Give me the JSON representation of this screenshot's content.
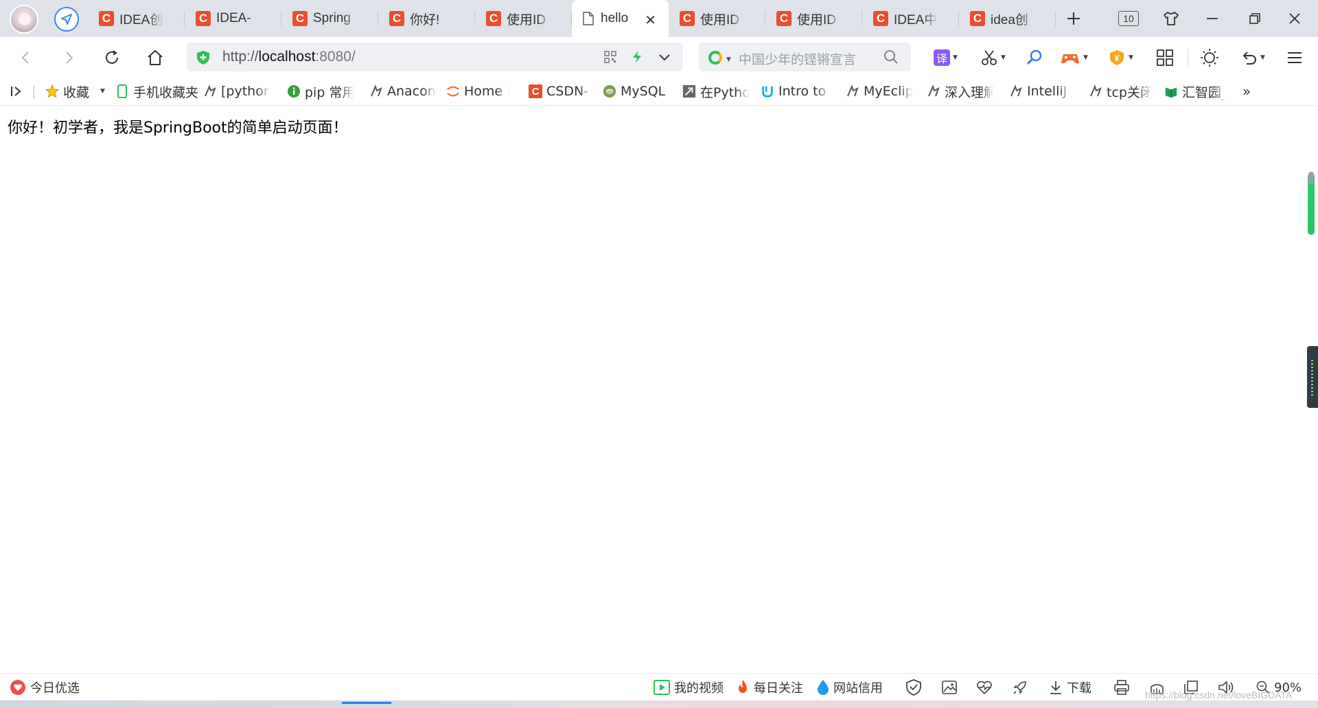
{
  "browser": {
    "tabs": [
      {
        "label": "IDEA创",
        "icon": "csdn-icon"
      },
      {
        "label": "IDEA-",
        "icon": "csdn-icon"
      },
      {
        "label": "Spring",
        "icon": "csdn-icon"
      },
      {
        "label": "你好!",
        "icon": "csdn-icon"
      },
      {
        "label": "使用ID",
        "icon": "csdn-icon"
      },
      {
        "label": "hello",
        "icon": "document-icon",
        "active": true
      },
      {
        "label": "使用ID",
        "icon": "csdn-icon"
      },
      {
        "label": "使用ID",
        "icon": "csdn-icon"
      },
      {
        "label": "IDEA中",
        "icon": "csdn-icon"
      },
      {
        "label": "idea创",
        "icon": "csdn-icon"
      }
    ],
    "tab_count": "10",
    "address": {
      "scheme": "http://",
      "host": "localhost",
      "port_path": ":8080/"
    },
    "search_placeholder": "中国少年的铿锵宣言"
  },
  "bookmarks": [
    {
      "label": "收藏",
      "icon": "star-icon"
    },
    {
      "label": "手机收藏夹",
      "icon": "phone-icon"
    },
    {
      "label": "[python]",
      "icon": "bookmark-logo-icon"
    },
    {
      "label": "pip 常用",
      "icon": "info-icon"
    },
    {
      "label": "Anacon",
      "icon": "bookmark-logo-icon"
    },
    {
      "label": "Home P",
      "icon": "jupyter-icon"
    },
    {
      "label": "CSDN-",
      "icon": "csdn-icon"
    },
    {
      "label": "MySQL",
      "icon": "mysql-icon"
    },
    {
      "label": "在Pytho",
      "icon": "arrow-icon"
    },
    {
      "label": "Intro to",
      "icon": "udacity-icon"
    },
    {
      "label": "MyEclip",
      "icon": "bookmark-logo-icon"
    },
    {
      "label": "深入理解",
      "icon": "bookmark-logo-icon"
    },
    {
      "label": "IntelliJ I",
      "icon": "bookmark-logo-icon"
    },
    {
      "label": "tcp关闭",
      "icon": "bookmark-logo-icon"
    },
    {
      "label": "汇智园_",
      "icon": "book-icon"
    }
  ],
  "bookmarks_more": "»",
  "page": {
    "text": "你好！初学者，我是SpringBoot的简单启动页面！"
  },
  "statusbar": {
    "left": "今日优选",
    "video": "我的视频",
    "daily": "每日关注",
    "credit": "网站信用",
    "download": "下载",
    "zoom": "90%"
  },
  "watermark": "https://blog.csdn.net/loveBIGDATA",
  "colors": {
    "tabbar_bg": "#dfe3e9",
    "csdn_red": "#e94e2e",
    "accent_green": "#2ecc71",
    "accent_blue": "#2e7be6"
  }
}
